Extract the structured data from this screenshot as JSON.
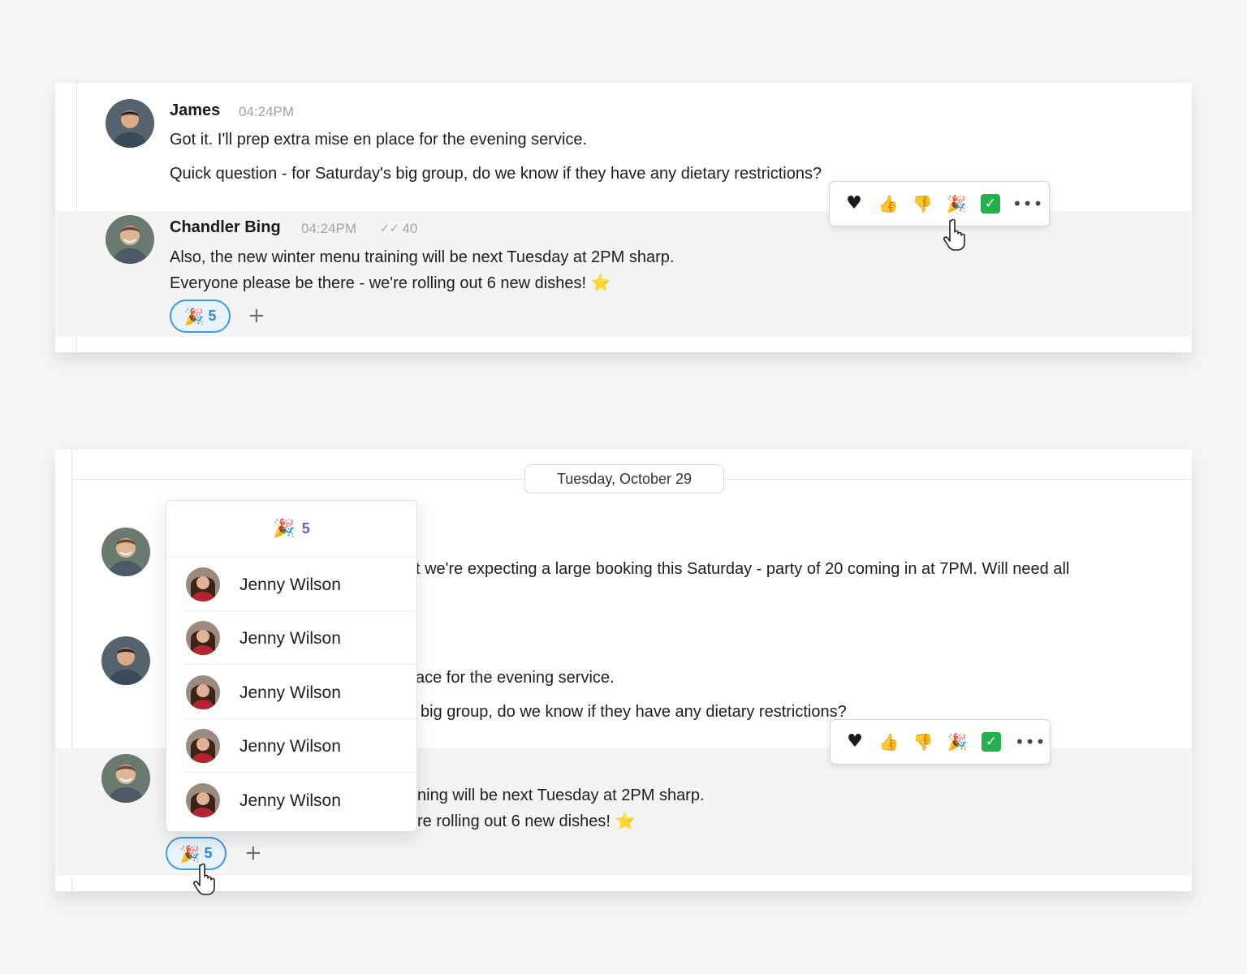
{
  "top": {
    "msg_james": {
      "author": "James",
      "time": "04:24PM",
      "line1": "Got it. I'll prep extra mise en place for the evening service.",
      "line2": "Quick question - for Saturday's big group, do we know if they have any dietary restrictions?"
    },
    "msg_chandler": {
      "author": "Chandler Bing",
      "time": "04:24PM",
      "seen_count": "40",
      "line1": "Also, the new winter menu training will be next Tuesday at 2PM sharp.",
      "line2": "Everyone please be there - we're rolling out 6 new dishes! ⭐"
    },
    "reaction_chip": {
      "emoji": "🎉",
      "count": "5"
    },
    "add_reaction": "+"
  },
  "reaction_bar": {
    "heart": "♥",
    "thumbs_up": "👍",
    "thumbs_down": "👎",
    "party": "🎉",
    "check": "✓",
    "more": "•••"
  },
  "bottom": {
    "date_divider": "Tuesday, October 29",
    "msg1_text": "t we're expecting a large booking this Saturday - party of 20 coming in at 7PM. Will need all",
    "msg2_line1": "ace for the evening service.",
    "msg2_line2": "big group, do we know if they have any dietary restrictions?",
    "msg3_line1": "ning will be next Tuesday at 2PM sharp.",
    "msg3_line2": "re rolling out 6 new dishes! ⭐",
    "reaction_chip": {
      "emoji": "🎉",
      "count": "5"
    },
    "add_reaction": "+"
  },
  "popover": {
    "emoji": "🎉",
    "count": "5",
    "users": [
      {
        "name": "Jenny Wilson"
      },
      {
        "name": "Jenny Wilson"
      },
      {
        "name": "Jenny Wilson"
      },
      {
        "name": "Jenny Wilson"
      },
      {
        "name": "Jenny Wilson"
      }
    ]
  },
  "colors": {
    "accent_blue": "#3a9be6",
    "highlight_bg": "#f4f4f4",
    "check_green": "#22b14c",
    "popover_count": "#6a5fd0"
  }
}
